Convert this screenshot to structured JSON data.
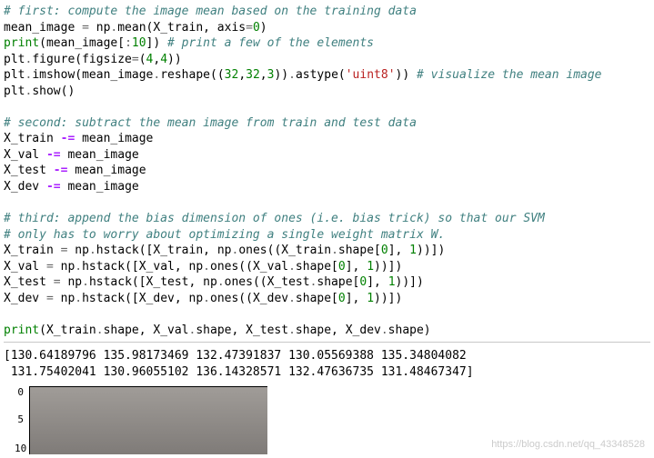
{
  "code": {
    "c1": "# first: compute the image mean based on the training data",
    "l1_a": "mean_image ",
    "l1_b": " np",
    "l1_c": "mean(X_train, axis",
    "l2_a": "(mean_image[",
    "l2_b": "10",
    "l2_c": "]) ",
    "c2": "# print a few of the elements",
    "l3_a": "plt",
    "l3_b": "figure(figsize",
    "l3_c": "(",
    "l3_d": "4",
    "l3_e": "4",
    "l4_a": "plt",
    "l4_b": "imshow(mean_image",
    "l4_c": "reshape((",
    "l4_d": "32",
    "l4_e": "32",
    "l4_f": "3",
    "l4_g": "))",
    "l4_h": "astype(",
    "s_uint8": "'uint8'",
    "c3": "# visualize the mean image",
    "l5_a": "plt",
    "l5_b": "show()",
    "c4": "# second: subtract the mean image from train and test data",
    "l6": "X_train ",
    "l6b": " mean_image",
    "l7": "X_val ",
    "l7b": " mean_image",
    "l8": "X_test ",
    "l8b": " mean_image",
    "l9": "X_dev ",
    "l9b": " mean_image",
    "c5": "# third: append the bias dimension of ones (i.e. bias trick) so that our SVM",
    "c6": "# only has to worry about optimizing a single weight matrix W.",
    "l10_a": "X_train ",
    "l10_b": " np",
    "l10_c": "hstack([X_train, np",
    "l10_d": "ones((X_train",
    "l10_e": "shape[",
    "l10_f": "0",
    "l10_g": "], ",
    "l10_h": "1",
    "l10_i": "))])",
    "l11_a": "X_val ",
    "l11_c": "hstack([X_val, np",
    "l11_d": "ones((X_val",
    "l12_a": "X_test ",
    "l12_c": "hstack([X_test, np",
    "l12_d": "ones((X_test",
    "l13_a": "X_dev ",
    "l13_c": "hstack([X_dev, np",
    "l13_d": "ones((X_dev",
    "l14_a": "(X_train",
    "l14_b": "shape, X_val",
    "l14_c": "shape, X_test",
    "l14_d": "shape, X_dev",
    "l14_e": "shape)",
    "kw_print": "print",
    "zero": "0",
    "one": "1",
    "eq": "=",
    "minuseq": "-=",
    "dot": ".",
    "colon": ":",
    "comma": ",",
    "rpar": ")"
  },
  "output": {
    "line1": "[130.64189796 135.98173469 132.47391837 130.05569388 135.34804082",
    "line2": " 131.75402041 130.96055102 136.14328571 132.47636735 131.48467347]"
  },
  "ticks": {
    "t0": "0",
    "t5": "5",
    "t10": "10"
  },
  "watermark": "https://blog.csdn.net/qq_43348528"
}
